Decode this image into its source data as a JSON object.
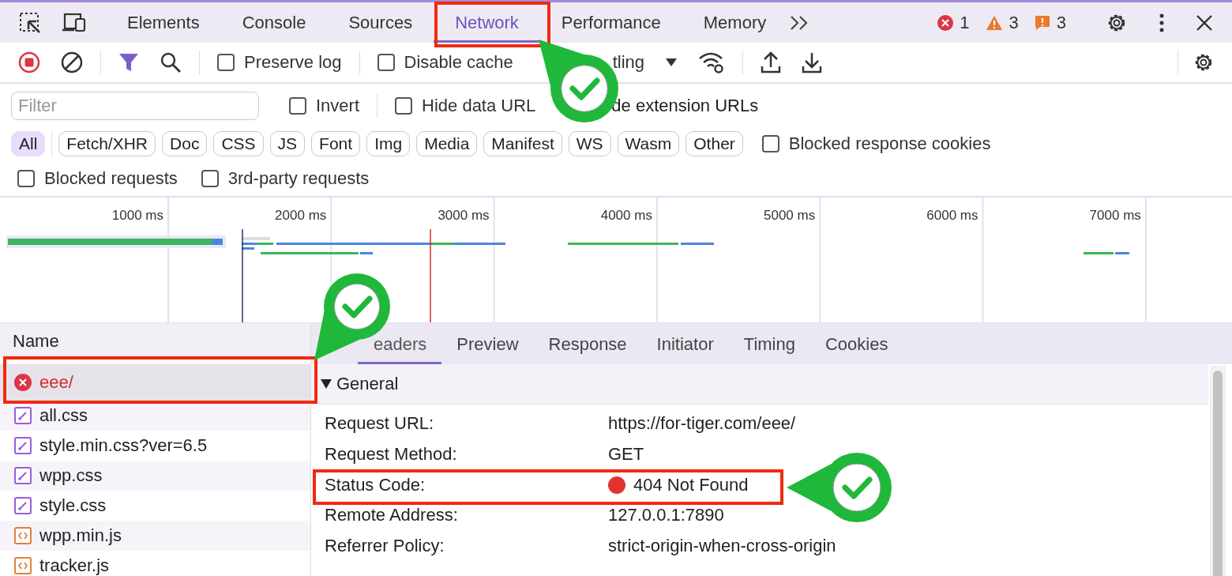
{
  "tabs": [
    {
      "label": "Elements",
      "selected": false
    },
    {
      "label": "Console",
      "selected": false
    },
    {
      "label": "Sources",
      "selected": false
    },
    {
      "label": "Network",
      "selected": true
    },
    {
      "label": "Performance",
      "selected": false
    },
    {
      "label": "Memory",
      "selected": false
    }
  ],
  "counters": [
    {
      "kind": "error",
      "count": "1"
    },
    {
      "kind": "warning",
      "count": "3"
    },
    {
      "kind": "issue",
      "count": "3"
    }
  ],
  "toolbar": {
    "recording": true,
    "checkboxes": [
      {
        "label": "Preserve log",
        "checked": false
      },
      {
        "label": "Disable cache",
        "checked": false
      }
    ],
    "throttling": "tling"
  },
  "filter": {
    "placeholder": "Filter",
    "invert": {
      "label": "Invert",
      "checked": false
    },
    "hide_data_urls": {
      "label": "Hide data URL",
      "checked": false
    },
    "hide_extension_urls": "de extension URLs"
  },
  "types": [
    {
      "label": "All",
      "selected": true
    },
    {
      "label": "Fetch/XHR",
      "selected": false
    },
    {
      "label": "Doc",
      "selected": false
    },
    {
      "label": "CSS",
      "selected": false
    },
    {
      "label": "JS",
      "selected": false
    },
    {
      "label": "Font",
      "selected": false
    },
    {
      "label": "Img",
      "selected": false
    },
    {
      "label": "Media",
      "selected": false
    },
    {
      "label": "Manifest",
      "selected": false
    },
    {
      "label": "WS",
      "selected": false
    },
    {
      "label": "Wasm",
      "selected": false
    },
    {
      "label": "Other",
      "selected": false
    }
  ],
  "blocked_cookies": {
    "label": "Blocked response cookies",
    "checked": false
  },
  "more_filters": [
    {
      "label": "Blocked requests",
      "checked": false
    },
    {
      "label": "3rd-party requests",
      "checked": false
    }
  ],
  "timeline": {
    "ticks": [
      "1000 ms",
      "2000 ms",
      "3000 ms",
      "4000 ms",
      "5000 ms",
      "6000 ms",
      "7000 ms"
    ]
  },
  "requests": {
    "header": "Name",
    "rows": [
      {
        "name": "eee/",
        "kind": "error",
        "selected": true
      },
      {
        "name": "all.css",
        "kind": "css",
        "selected": false
      },
      {
        "name": "style.min.css?ver=6.5",
        "kind": "css",
        "selected": false
      },
      {
        "name": "wpp.css",
        "kind": "css",
        "selected": false
      },
      {
        "name": "style.css",
        "kind": "css",
        "selected": false
      },
      {
        "name": "wpp.min.js",
        "kind": "js",
        "selected": false
      },
      {
        "name": "tracker.js",
        "kind": "js",
        "selected": false
      }
    ]
  },
  "details": {
    "tabs": [
      {
        "label": "eaders",
        "selected": true
      },
      {
        "label": "Preview",
        "selected": false
      },
      {
        "label": "Response",
        "selected": false
      },
      {
        "label": "Initiator",
        "selected": false
      },
      {
        "label": "Timing",
        "selected": false
      },
      {
        "label": "Cookies",
        "selected": false
      }
    ],
    "section": {
      "title": "General",
      "expanded": true
    },
    "fields": [
      {
        "label": "Request URL:",
        "value": "https://for-tiger.com/eee/"
      },
      {
        "label": "Request Method:",
        "value": "GET"
      },
      {
        "label": "Status Code:",
        "value": "404 Not Found",
        "color": "#e0342c"
      },
      {
        "label": "Remote Address:",
        "value": "127.0.0.1:7890"
      },
      {
        "label": "Referrer Policy:",
        "value": "strict-origin-when-cross-origin"
      }
    ]
  }
}
